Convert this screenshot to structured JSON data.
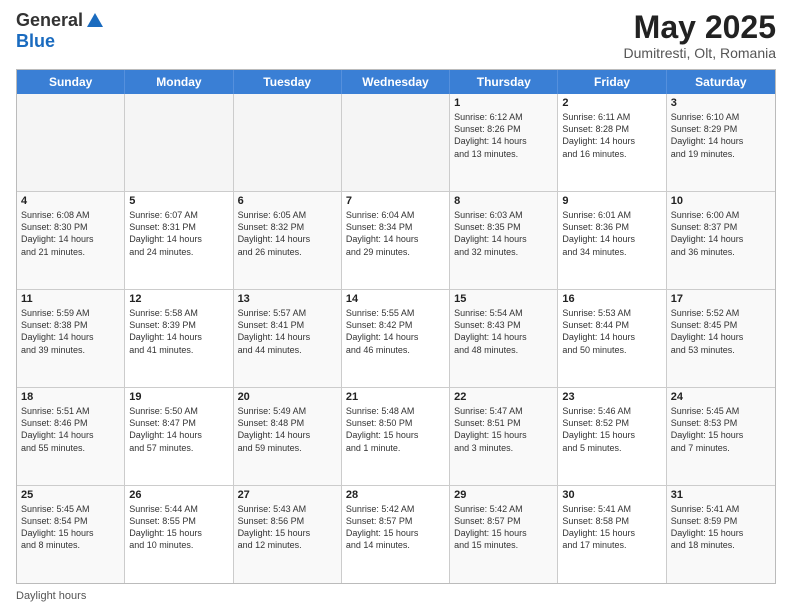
{
  "header": {
    "logo_general": "General",
    "logo_blue": "Blue",
    "month_title": "May 2025",
    "subtitle": "Dumitresti, Olt, Romania"
  },
  "calendar": {
    "days_of_week": [
      "Sunday",
      "Monday",
      "Tuesday",
      "Wednesday",
      "Thursday",
      "Friday",
      "Saturday"
    ],
    "weeks": [
      [
        {
          "day": "",
          "info": "",
          "empty": true
        },
        {
          "day": "",
          "info": "",
          "empty": true
        },
        {
          "day": "",
          "info": "",
          "empty": true
        },
        {
          "day": "",
          "info": "",
          "empty": true
        },
        {
          "day": "1",
          "info": "Sunrise: 6:12 AM\nSunset: 8:26 PM\nDaylight: 14 hours\nand 13 minutes.",
          "empty": false
        },
        {
          "day": "2",
          "info": "Sunrise: 6:11 AM\nSunset: 8:28 PM\nDaylight: 14 hours\nand 16 minutes.",
          "empty": false
        },
        {
          "day": "3",
          "info": "Sunrise: 6:10 AM\nSunset: 8:29 PM\nDaylight: 14 hours\nand 19 minutes.",
          "empty": false
        }
      ],
      [
        {
          "day": "4",
          "info": "Sunrise: 6:08 AM\nSunset: 8:30 PM\nDaylight: 14 hours\nand 21 minutes.",
          "empty": false
        },
        {
          "day": "5",
          "info": "Sunrise: 6:07 AM\nSunset: 8:31 PM\nDaylight: 14 hours\nand 24 minutes.",
          "empty": false
        },
        {
          "day": "6",
          "info": "Sunrise: 6:05 AM\nSunset: 8:32 PM\nDaylight: 14 hours\nand 26 minutes.",
          "empty": false
        },
        {
          "day": "7",
          "info": "Sunrise: 6:04 AM\nSunset: 8:34 PM\nDaylight: 14 hours\nand 29 minutes.",
          "empty": false
        },
        {
          "day": "8",
          "info": "Sunrise: 6:03 AM\nSunset: 8:35 PM\nDaylight: 14 hours\nand 32 minutes.",
          "empty": false
        },
        {
          "day": "9",
          "info": "Sunrise: 6:01 AM\nSunset: 8:36 PM\nDaylight: 14 hours\nand 34 minutes.",
          "empty": false
        },
        {
          "day": "10",
          "info": "Sunrise: 6:00 AM\nSunset: 8:37 PM\nDaylight: 14 hours\nand 36 minutes.",
          "empty": false
        }
      ],
      [
        {
          "day": "11",
          "info": "Sunrise: 5:59 AM\nSunset: 8:38 PM\nDaylight: 14 hours\nand 39 minutes.",
          "empty": false
        },
        {
          "day": "12",
          "info": "Sunrise: 5:58 AM\nSunset: 8:39 PM\nDaylight: 14 hours\nand 41 minutes.",
          "empty": false
        },
        {
          "day": "13",
          "info": "Sunrise: 5:57 AM\nSunset: 8:41 PM\nDaylight: 14 hours\nand 44 minutes.",
          "empty": false
        },
        {
          "day": "14",
          "info": "Sunrise: 5:55 AM\nSunset: 8:42 PM\nDaylight: 14 hours\nand 46 minutes.",
          "empty": false
        },
        {
          "day": "15",
          "info": "Sunrise: 5:54 AM\nSunset: 8:43 PM\nDaylight: 14 hours\nand 48 minutes.",
          "empty": false
        },
        {
          "day": "16",
          "info": "Sunrise: 5:53 AM\nSunset: 8:44 PM\nDaylight: 14 hours\nand 50 minutes.",
          "empty": false
        },
        {
          "day": "17",
          "info": "Sunrise: 5:52 AM\nSunset: 8:45 PM\nDaylight: 14 hours\nand 53 minutes.",
          "empty": false
        }
      ],
      [
        {
          "day": "18",
          "info": "Sunrise: 5:51 AM\nSunset: 8:46 PM\nDaylight: 14 hours\nand 55 minutes.",
          "empty": false
        },
        {
          "day": "19",
          "info": "Sunrise: 5:50 AM\nSunset: 8:47 PM\nDaylight: 14 hours\nand 57 minutes.",
          "empty": false
        },
        {
          "day": "20",
          "info": "Sunrise: 5:49 AM\nSunset: 8:48 PM\nDaylight: 14 hours\nand 59 minutes.",
          "empty": false
        },
        {
          "day": "21",
          "info": "Sunrise: 5:48 AM\nSunset: 8:50 PM\nDaylight: 15 hours\nand 1 minute.",
          "empty": false
        },
        {
          "day": "22",
          "info": "Sunrise: 5:47 AM\nSunset: 8:51 PM\nDaylight: 15 hours\nand 3 minutes.",
          "empty": false
        },
        {
          "day": "23",
          "info": "Sunrise: 5:46 AM\nSunset: 8:52 PM\nDaylight: 15 hours\nand 5 minutes.",
          "empty": false
        },
        {
          "day": "24",
          "info": "Sunrise: 5:45 AM\nSunset: 8:53 PM\nDaylight: 15 hours\nand 7 minutes.",
          "empty": false
        }
      ],
      [
        {
          "day": "25",
          "info": "Sunrise: 5:45 AM\nSunset: 8:54 PM\nDaylight: 15 hours\nand 8 minutes.",
          "empty": false
        },
        {
          "day": "26",
          "info": "Sunrise: 5:44 AM\nSunset: 8:55 PM\nDaylight: 15 hours\nand 10 minutes.",
          "empty": false
        },
        {
          "day": "27",
          "info": "Sunrise: 5:43 AM\nSunset: 8:56 PM\nDaylight: 15 hours\nand 12 minutes.",
          "empty": false
        },
        {
          "day": "28",
          "info": "Sunrise: 5:42 AM\nSunset: 8:57 PM\nDaylight: 15 hours\nand 14 minutes.",
          "empty": false
        },
        {
          "day": "29",
          "info": "Sunrise: 5:42 AM\nSunset: 8:57 PM\nDaylight: 15 hours\nand 15 minutes.",
          "empty": false
        },
        {
          "day": "30",
          "info": "Sunrise: 5:41 AM\nSunset: 8:58 PM\nDaylight: 15 hours\nand 17 minutes.",
          "empty": false
        },
        {
          "day": "31",
          "info": "Sunrise: 5:41 AM\nSunset: 8:59 PM\nDaylight: 15 hours\nand 18 minutes.",
          "empty": false
        }
      ]
    ]
  },
  "footer": {
    "daylight_label": "Daylight hours"
  }
}
